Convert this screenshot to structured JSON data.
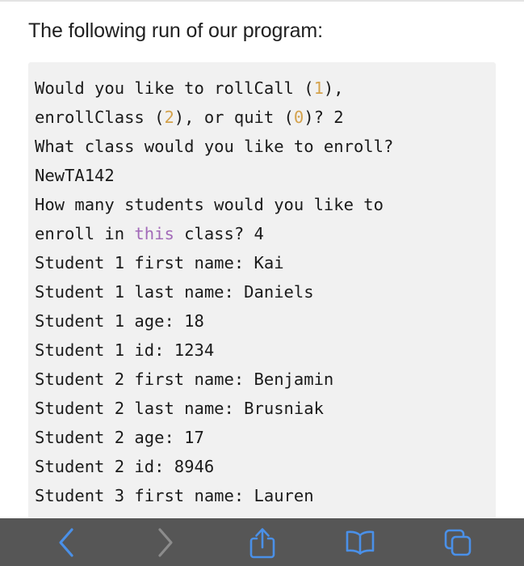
{
  "page": {
    "intro_paragraph": "The following run of our program:"
  },
  "code_block": {
    "language": "console-transcript",
    "lines": [
      {
        "segments": [
          {
            "text": "Would you like to rollCall (",
            "type": "plain"
          },
          {
            "text": "1",
            "type": "number"
          },
          {
            "text": "),",
            "type": "plain"
          }
        ]
      },
      {
        "segments": [
          {
            "text": "enrollClass (",
            "type": "plain"
          },
          {
            "text": "2",
            "type": "number"
          },
          {
            "text": "), or quit (",
            "type": "plain"
          },
          {
            "text": "0",
            "type": "number"
          },
          {
            "text": ")? 2",
            "type": "plain"
          }
        ]
      },
      {
        "segments": [
          {
            "text": "What class would you like to enroll?",
            "type": "plain"
          }
        ]
      },
      {
        "segments": [
          {
            "text": "NewTA142",
            "type": "plain"
          }
        ]
      },
      {
        "segments": [
          {
            "text": "How many students would you like to",
            "type": "plain"
          }
        ]
      },
      {
        "segments": [
          {
            "text": "enroll in ",
            "type": "plain"
          },
          {
            "text": "this",
            "type": "keyword"
          },
          {
            "text": " class? 4",
            "type": "plain"
          }
        ]
      },
      {
        "segments": [
          {
            "text": "Student 1 first name: Kai",
            "type": "plain"
          }
        ]
      },
      {
        "segments": [
          {
            "text": "Student 1 last name: Daniels",
            "type": "plain"
          }
        ]
      },
      {
        "segments": [
          {
            "text": "Student 1 age: 18",
            "type": "plain"
          }
        ]
      },
      {
        "segments": [
          {
            "text": "Student 1 id: 1234",
            "type": "plain"
          }
        ]
      },
      {
        "segments": [
          {
            "text": "Student 2 first name: Benjamin",
            "type": "plain"
          }
        ]
      },
      {
        "segments": [
          {
            "text": "Student 2 last name: Brusniak",
            "type": "plain"
          }
        ]
      },
      {
        "segments": [
          {
            "text": "Student 2 age: 17",
            "type": "plain"
          }
        ]
      },
      {
        "segments": [
          {
            "text": "Student 2 id: 8946",
            "type": "plain"
          }
        ]
      },
      {
        "segments": [
          {
            "text": "Student 3 first name: Lauren",
            "type": "plain"
          }
        ]
      }
    ]
  },
  "toolbar": {
    "buttons": [
      {
        "name": "back",
        "icon": "chevron-left-icon",
        "enabled": true
      },
      {
        "name": "forward",
        "icon": "chevron-right-icon",
        "enabled": false
      },
      {
        "name": "share",
        "icon": "share-icon",
        "enabled": true
      },
      {
        "name": "bookmarks",
        "icon": "book-icon",
        "enabled": true
      },
      {
        "name": "tabs",
        "icon": "tabs-icon",
        "enabled": true
      }
    ]
  },
  "colors": {
    "code_background": "#f1f1f1",
    "page_background": "#ffffff",
    "toolbar_background": "#565656",
    "accent_enabled": "#4a90e8",
    "accent_disabled": "#8c8c8c",
    "syntax_number": "#d4a24c",
    "syntax_keyword": "#a269b8",
    "text_primary": "#1a1a1a"
  }
}
